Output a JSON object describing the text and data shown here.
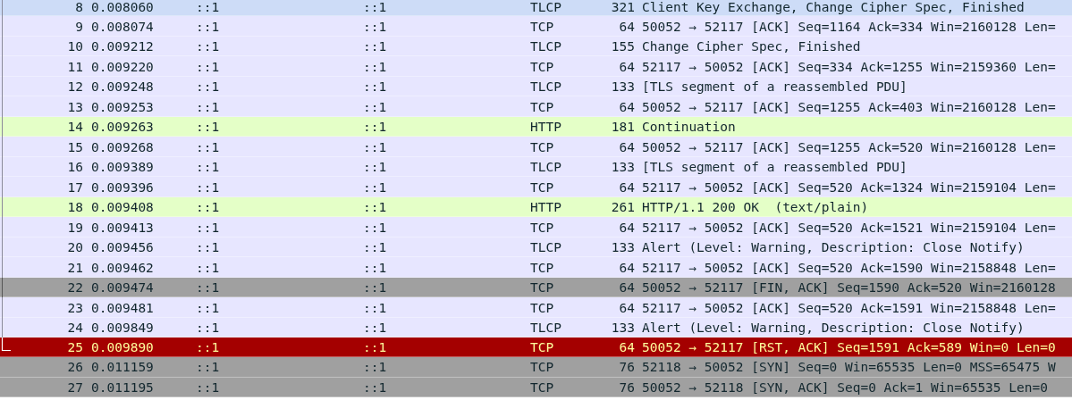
{
  "packets": [
    {
      "no": "8",
      "time": "0.008060",
      "source": "::1",
      "destination": "::1",
      "protocol": "TLCP",
      "length": "321",
      "info": "Client Key Exchange, Change Cipher Spec, Finished",
      "kind": "tcp",
      "selected": true,
      "related": true
    },
    {
      "no": "9",
      "time": "0.008074",
      "source": "::1",
      "destination": "::1",
      "protocol": "TCP",
      "length": "64",
      "info": "50052 → 52117 [ACK] Seq=1164 Ack=334 Win=2160128 Len=",
      "kind": "tcp",
      "selected": false,
      "related": true
    },
    {
      "no": "10",
      "time": "0.009212",
      "source": "::1",
      "destination": "::1",
      "protocol": "TLCP",
      "length": "155",
      "info": "Change Cipher Spec, Finished",
      "kind": "tcp",
      "selected": false,
      "related": true
    },
    {
      "no": "11",
      "time": "0.009220",
      "source": "::1",
      "destination": "::1",
      "protocol": "TCP",
      "length": "64",
      "info": "52117 → 50052 [ACK] Seq=334 Ack=1255 Win=2159360 Len=",
      "kind": "tcp",
      "selected": false,
      "related": true
    },
    {
      "no": "12",
      "time": "0.009248",
      "source": "::1",
      "destination": "::1",
      "protocol": "TLCP",
      "length": "133",
      "info": "[TLS segment of a reassembled PDU]",
      "kind": "tcp",
      "selected": false,
      "related": true
    },
    {
      "no": "13",
      "time": "0.009253",
      "source": "::1",
      "destination": "::1",
      "protocol": "TCP",
      "length": "64",
      "info": "50052 → 52117 [ACK] Seq=1255 Ack=403 Win=2160128 Len=",
      "kind": "tcp",
      "selected": false,
      "related": true
    },
    {
      "no": "14",
      "time": "0.009263",
      "source": "::1",
      "destination": "::1",
      "protocol": "HTTP",
      "length": "181",
      "info": "Continuation",
      "kind": "http",
      "selected": false,
      "related": true
    },
    {
      "no": "15",
      "time": "0.009268",
      "source": "::1",
      "destination": "::1",
      "protocol": "TCP",
      "length": "64",
      "info": "50052 → 52117 [ACK] Seq=1255 Ack=520 Win=2160128 Len=",
      "kind": "tcp",
      "selected": false,
      "related": true
    },
    {
      "no": "16",
      "time": "0.009389",
      "source": "::1",
      "destination": "::1",
      "protocol": "TLCP",
      "length": "133",
      "info": "[TLS segment of a reassembled PDU]",
      "kind": "tcp",
      "selected": false,
      "related": true
    },
    {
      "no": "17",
      "time": "0.009396",
      "source": "::1",
      "destination": "::1",
      "protocol": "TCP",
      "length": "64",
      "info": "52117 → 50052 [ACK] Seq=520 Ack=1324 Win=2159104 Len=",
      "kind": "tcp",
      "selected": false,
      "related": true
    },
    {
      "no": "18",
      "time": "0.009408",
      "source": "::1",
      "destination": "::1",
      "protocol": "HTTP",
      "length": "261",
      "info": "HTTP/1.1 200 OK  (text/plain)",
      "kind": "http",
      "selected": false,
      "related": true
    },
    {
      "no": "19",
      "time": "0.009413",
      "source": "::1",
      "destination": "::1",
      "protocol": "TCP",
      "length": "64",
      "info": "52117 → 50052 [ACK] Seq=520 Ack=1521 Win=2159104 Len=",
      "kind": "tcp",
      "selected": false,
      "related": true
    },
    {
      "no": "20",
      "time": "0.009456",
      "source": "::1",
      "destination": "::1",
      "protocol": "TLCP",
      "length": "133",
      "info": "Alert (Level: Warning, Description: Close Notify)",
      "kind": "tcp",
      "selected": false,
      "related": true
    },
    {
      "no": "21",
      "time": "0.009462",
      "source": "::1",
      "destination": "::1",
      "protocol": "TCP",
      "length": "64",
      "info": "52117 → 50052 [ACK] Seq=520 Ack=1590 Win=2158848 Len=",
      "kind": "tcp",
      "selected": false,
      "related": true
    },
    {
      "no": "22",
      "time": "0.009474",
      "source": "::1",
      "destination": "::1",
      "protocol": "TCP",
      "length": "64",
      "info": "50052 → 52117 [FIN, ACK] Seq=1590 Ack=520 Win=2160128",
      "kind": "synfin",
      "selected": false,
      "related": true
    },
    {
      "no": "23",
      "time": "0.009481",
      "source": "::1",
      "destination": "::1",
      "protocol": "TCP",
      "length": "64",
      "info": "52117 → 50052 [ACK] Seq=520 Ack=1591 Win=2158848 Len=",
      "kind": "tcp",
      "selected": false,
      "related": true
    },
    {
      "no": "24",
      "time": "0.009849",
      "source": "::1",
      "destination": "::1",
      "protocol": "TLCP",
      "length": "133",
      "info": "Alert (Level: Warning, Description: Close Notify)",
      "kind": "tcp",
      "selected": false,
      "related": true
    },
    {
      "no": "25",
      "time": "0.009890",
      "source": "::1",
      "destination": "::1",
      "protocol": "TCP",
      "length": "64",
      "info": "50052 → 52117 [RST, ACK] Seq=1591 Ack=589 Win=0 Len=0",
      "kind": "rst",
      "selected": false,
      "related": true
    },
    {
      "no": "26",
      "time": "0.011159",
      "source": "::1",
      "destination": "::1",
      "protocol": "TCP",
      "length": "76",
      "info": "52118 → 50052 [SYN] Seq=0 Win=65535 Len=0 MSS=65475 W",
      "kind": "synfin",
      "selected": false,
      "related": false
    },
    {
      "no": "27",
      "time": "0.011195",
      "source": "::1",
      "destination": "::1",
      "protocol": "TCP",
      "length": "76",
      "info": "50052 → 52118 [SYN, ACK] Seq=0 Ack=1 Win=65535 Len=0",
      "kind": "synfin",
      "selected": false,
      "related": false
    }
  ]
}
